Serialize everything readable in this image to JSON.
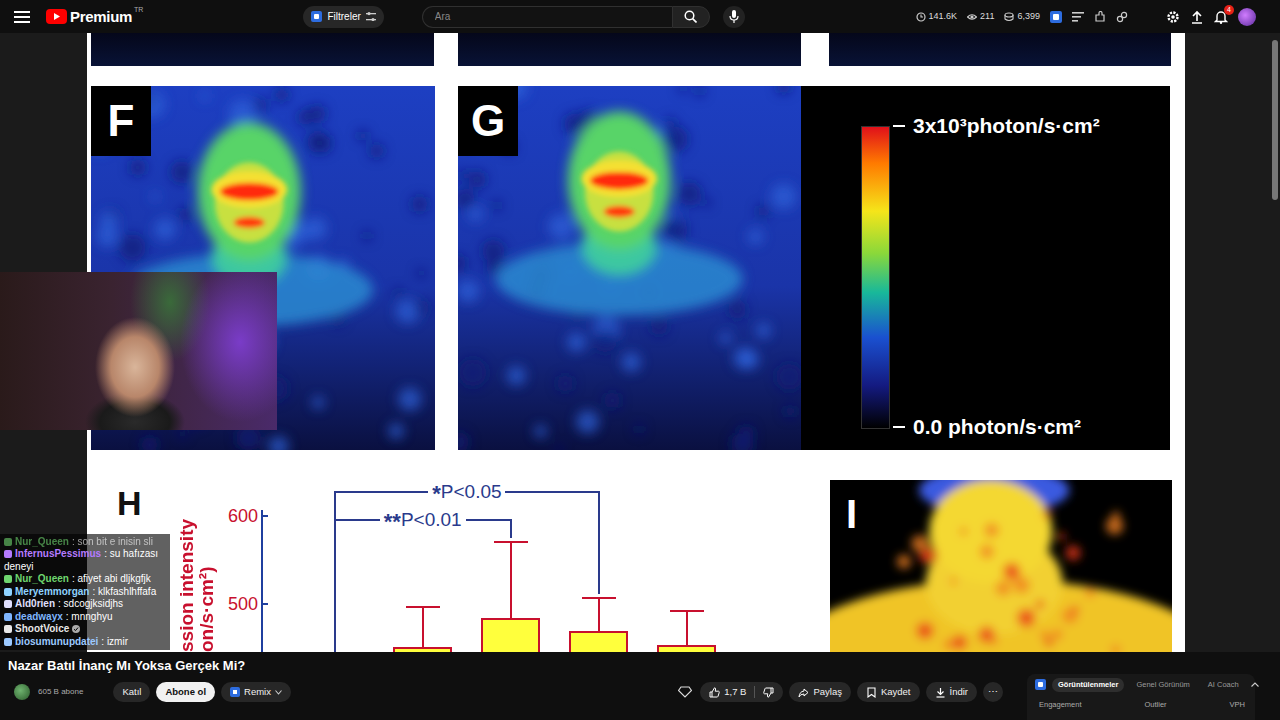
{
  "topbar": {
    "brand": "Premium",
    "region": "TR",
    "filter": "Filtreler",
    "search": {
      "placeholder": "Ara"
    },
    "stats": [
      {
        "value": "141.6K"
      },
      {
        "value": "211"
      },
      {
        "value": "6,399"
      }
    ],
    "notifications": "4"
  },
  "figure": {
    "panels": [
      {
        "label": "F"
      },
      {
        "label": "G"
      },
      {
        "label": "I"
      }
    ],
    "colorbar": {
      "max": "3x10³photon/s·cm²",
      "min": "0.0 photon/s·cm²"
    },
    "chart": {
      "label": "H",
      "y_title_lines": [
        "ssion intensity",
        "on/s·cm²)"
      ],
      "ticks": [
        {
          "text": "600",
          "value": 600
        },
        {
          "text": "500",
          "value": 500
        }
      ],
      "series": [
        {
          "values": [
            451,
            484,
            469,
            453
          ],
          "error_high": [
            498,
            572,
            508,
            493
          ]
        }
      ],
      "comparisons": [
        {
          "mark": "*",
          "text": "P<0.05",
          "to_bar": 2,
          "y": 627
        },
        {
          "mark": "**",
          "text": "P<0.01",
          "to_bar": 1,
          "y": 595
        }
      ]
    }
  },
  "chat": [
    {
      "user": "Nur_Queen",
      "text": ": son bit e inisin sli",
      "color": "#6fd66f",
      "faded": true,
      "verified": false
    },
    {
      "user": "InfernusPessimus",
      "text": ": su hafızası deneyi",
      "color": "#b57bff",
      "faded": false,
      "verified": false
    },
    {
      "user": "Nur_Queen",
      "text": ": afiyet abi dljkgfjk",
      "color": "#6fd66f",
      "faded": false,
      "verified": false
    },
    {
      "user": "Meryemmorgan",
      "text": ": klkfashlhffafa",
      "color": "#8fd3ff",
      "faded": false,
      "verified": false
    },
    {
      "user": "Ald0rien",
      "text": ": sdcogjksidjhs",
      "color": "#e0e0ff",
      "faded": false,
      "verified": false
    },
    {
      "user": "deadwayx",
      "text": ": mnnghyu",
      "color": "#7fb6ff",
      "faded": false,
      "verified": false
    },
    {
      "user": "ShootVoice",
      "color": "#e8e8e8",
      "faded": false,
      "verified": true
    },
    {
      "user": "biosumunupdatei",
      "text": ": izmir",
      "color": "#9cc9ff",
      "faded": false,
      "verified": false
    }
  ],
  "video": {
    "title": "Nazar Batıl İnanç Mı Yoksa Gerçek Mi?",
    "subscribers": "605 B abone",
    "join": "Katıl",
    "subscribe": "Abone ol",
    "remix": "Remix",
    "likes": "1,7 B",
    "share": "Paylaş",
    "save": "Kaydet",
    "download": "İndir",
    "more": "⋯"
  },
  "analytics": {
    "tabs": [
      {
        "label": "Görüntülenmeler",
        "selected": true
      },
      {
        "label": "Genel Görünüm",
        "selected": false
      },
      {
        "label": "AI Coach",
        "selected": false
      }
    ],
    "metrics": [
      "Engagement",
      "Outlier",
      "VPH"
    ]
  }
}
